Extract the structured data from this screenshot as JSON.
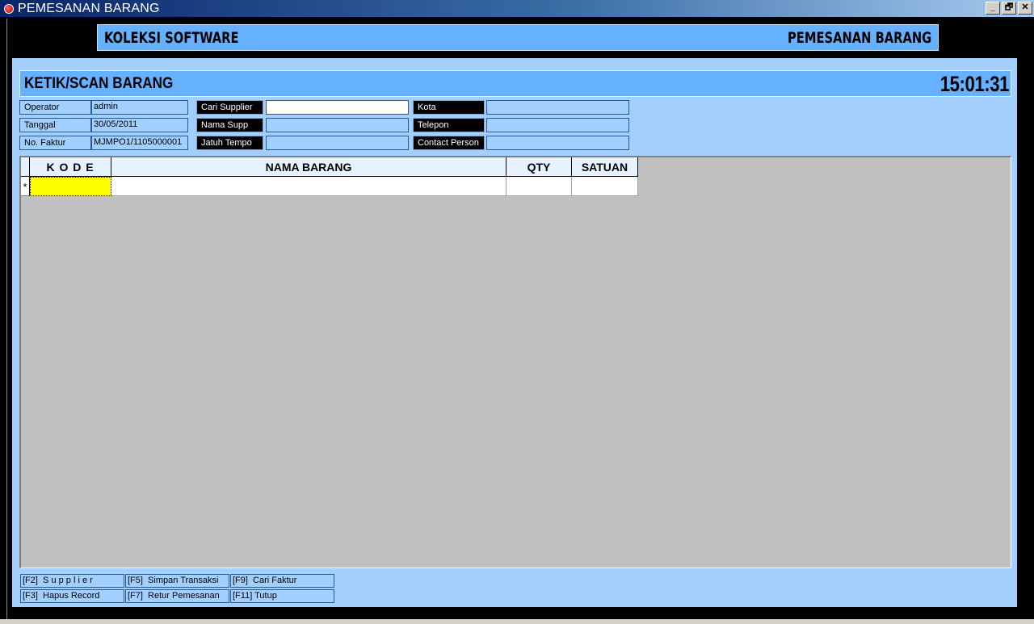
{
  "window": {
    "title": "PEMESANAN BARANG",
    "icon": "app-logo-icon",
    "buttons": [
      "_",
      "🗗",
      "✕"
    ]
  },
  "banner": {
    "left": "KOLEKSI SOFTWARE",
    "right": "PEMESANAN BARANG"
  },
  "header": {
    "title": "KETIK/SCAN BARANG",
    "clock": "15:01:31"
  },
  "info": {
    "operator_label": "Operator",
    "operator_value": "admin",
    "tanggal_label": "Tanggal",
    "tanggal_value": "30/05/2011",
    "faktur_label": "No. Faktur",
    "faktur_value": "MJMPO1/1105000001",
    "cari_supplier_label": "Cari Supplier",
    "cari_supplier_value": "",
    "nama_supp_label": "Nama Supp",
    "nama_supp_value": "",
    "jatuh_tempo_label": "Jatuh Tempo",
    "jatuh_tempo_value": "",
    "kota_label": "Kota",
    "kota_value": "",
    "telepon_label": "Telepon",
    "telepon_value": "",
    "contact_label": "Contact Person",
    "contact_value": ""
  },
  "grid": {
    "columns": [
      "K O D E",
      "NAMA BARANG",
      "QTY",
      "SATUAN"
    ],
    "new_row_marker": "*"
  },
  "fkeys": {
    "f2": "[F2]  S u p p l i e r",
    "f5": "[F5]  Simpan Transaksi",
    "f9": "[F9]  Cari Faktur",
    "f3": "[F3]  Hapus Record",
    "f7": "[F7]  Retur Pemesanan",
    "f11": "[F11] Tutup"
  },
  "colors": {
    "panel": "#a3cfff",
    "bar": "#65b0ff",
    "active_cell": "#ffff00"
  }
}
